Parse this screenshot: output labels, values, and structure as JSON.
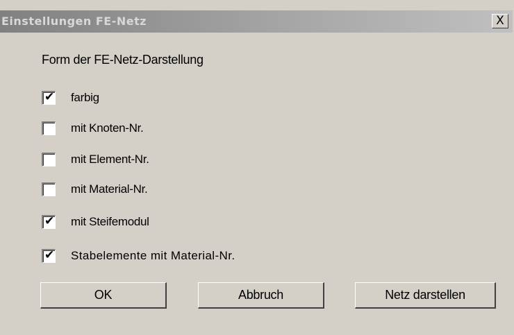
{
  "window": {
    "title": "Einstellungen FE-Netz",
    "close_label": "X"
  },
  "group": {
    "label": "Form der FE-Netz-Darstellung"
  },
  "options": [
    {
      "label": "farbig",
      "checked": true
    },
    {
      "label": "mit Knoten-Nr.",
      "checked": false
    },
    {
      "label": "mit Element-Nr.",
      "checked": false
    },
    {
      "label": "mit Material-Nr.",
      "checked": false
    },
    {
      "label": "mit Steifemodul",
      "checked": true
    },
    {
      "label": "Stabelemente mit Material-Nr.",
      "checked": true
    }
  ],
  "buttons": {
    "ok": "OK",
    "cancel": "Abbruch",
    "show_mesh": "Netz darstellen"
  }
}
